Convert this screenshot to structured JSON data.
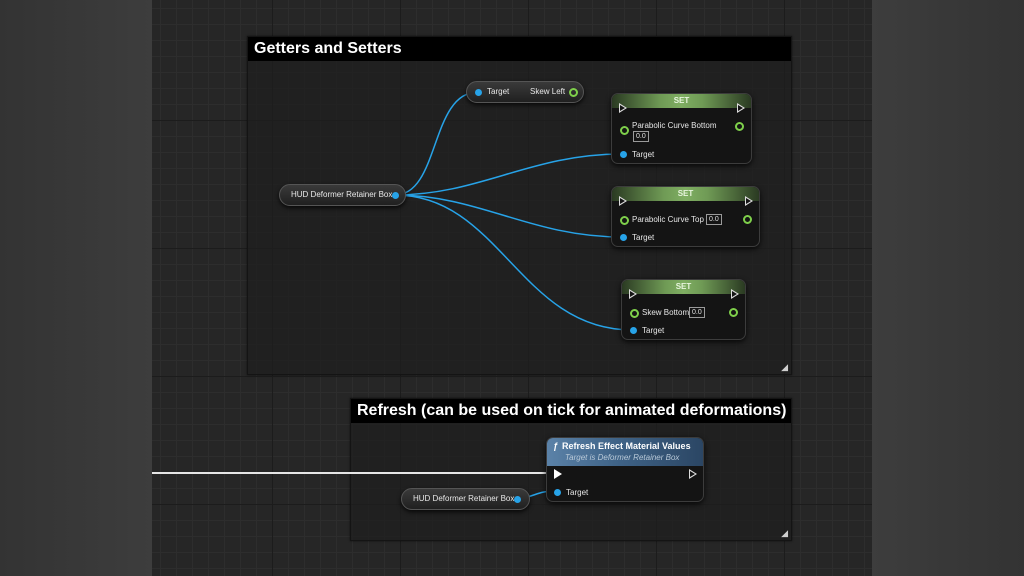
{
  "colors": {
    "wire_blue": "#27a3e8",
    "pin_green": "#7fd04b",
    "exec_wire": "#e6e6e6",
    "set_header": "#7fae62",
    "function_header": "#4a6f95"
  },
  "comments": {
    "getters_setters": "Getters and Setters",
    "refresh": "Refresh (can be used on tick for animated deformations)"
  },
  "nodes": {
    "get_skew": {
      "target_label": "Target",
      "output_label": "Skew Left"
    },
    "hud_top": {
      "label": "HUD Deformer Retainer Box"
    },
    "set_bottom": {
      "header": "SET",
      "pin_label": "Parabolic Curve Bottom",
      "value": "0.0",
      "target_label": "Target"
    },
    "set_top": {
      "header": "SET",
      "pin_label": "Parabolic Curve Top",
      "value": "0.0",
      "target_label": "Target"
    },
    "set_skew": {
      "header": "SET",
      "pin_label": "Skew Bottom",
      "value": "0.0",
      "target_label": "Target"
    },
    "refresh": {
      "title": "Refresh Effect Material Values",
      "subtitle": "Target is Deformer Retainer Box",
      "target_label": "Target"
    },
    "hud_bottom": {
      "label": "HUD Deformer Retainer Box"
    }
  },
  "icons": {
    "function": "function-icon",
    "resize": "resize-grip-icon"
  }
}
